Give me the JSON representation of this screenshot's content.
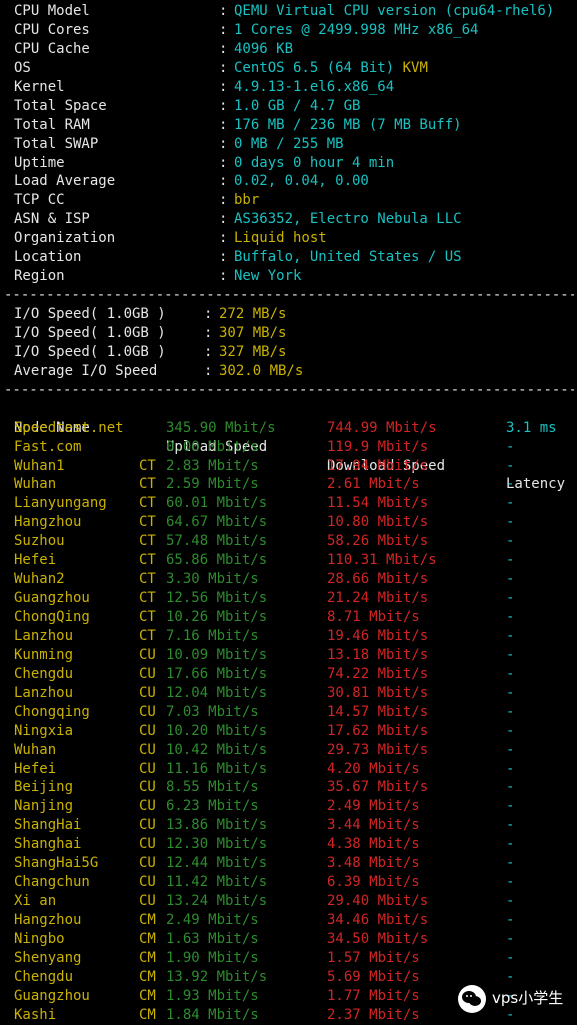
{
  "sysinfo": [
    {
      "label": "CPU Model",
      "value": "QEMU Virtual CPU version (cpu64-rhel6)"
    },
    {
      "label": "CPU Cores",
      "value": "1 Cores @ 2499.998 MHz x86_64"
    },
    {
      "label": "CPU Cache",
      "value": "4096 KB"
    },
    {
      "label": "OS",
      "value": "CentOS 6.5 (64 Bit)",
      "suffix": "KVM"
    },
    {
      "label": "Kernel",
      "value": "4.9.13-1.el6.x86_64"
    },
    {
      "label": "Total Space",
      "value": "1.0 GB / 4.7 GB"
    },
    {
      "label": "Total RAM",
      "value": "176 MB / 236 MB (7 MB Buff)"
    },
    {
      "label": "Total SWAP",
      "value": "0 MB / 255 MB"
    },
    {
      "label": "Uptime",
      "value": "0 days 0 hour 4 min"
    },
    {
      "label": "Load Average",
      "value": "0.02, 0.04, 0.00"
    },
    {
      "label": "TCP CC",
      "value": "bbr",
      "yellow": true
    },
    {
      "label": "ASN & ISP",
      "value": "AS36352, Electro Nebula LLC"
    },
    {
      "label": "Organization",
      "value": "Liquid host",
      "yellow": true
    },
    {
      "label": "Location",
      "value": "Buffalo, United States / US"
    },
    {
      "label": "Region",
      "value": "New York"
    }
  ],
  "io": [
    {
      "label": "I/O Speed( 1.0GB )",
      "value": "272 MB/s"
    },
    {
      "label": "I/O Speed( 1.0GB )",
      "value": "307 MB/s"
    },
    {
      "label": "I/O Speed( 1.0GB )",
      "value": "327 MB/s"
    },
    {
      "label": "Average I/O Speed",
      "value": "302.0 MB/s"
    }
  ],
  "speed_header": {
    "node": "Node Name",
    "upload": "Upload Speed",
    "download": "Download Speed",
    "latency": "Latency"
  },
  "speed_rows": [
    {
      "node": "Speedtest.net",
      "isp": "",
      "up": "345.90 Mbit/s",
      "down": "744.99 Mbit/s",
      "lat": "3.1 ms"
    },
    {
      "node": "Fast.com",
      "isp": "",
      "up": "0.00 Mbit/s",
      "down": "119.9 Mbit/s",
      "lat": "-"
    },
    {
      "node": "Wuhan1",
      "isp": "CT",
      "up": "2.83 Mbit/s",
      "down": "17.94 Mbit/s",
      "lat": "-"
    },
    {
      "node": "Wuhan",
      "isp": "CT",
      "up": "2.59 Mbit/s",
      "down": "2.61 Mbit/s",
      "lat": "-"
    },
    {
      "node": "Lianyungang",
      "isp": "CT",
      "up": "60.01 Mbit/s",
      "down": "11.54 Mbit/s",
      "lat": "-"
    },
    {
      "node": "Hangzhou",
      "isp": "CT",
      "up": "64.67 Mbit/s",
      "down": "10.80 Mbit/s",
      "lat": "-"
    },
    {
      "node": "Suzhou",
      "isp": "CT",
      "up": "57.48 Mbit/s",
      "down": "58.26 Mbit/s",
      "lat": "-"
    },
    {
      "node": "Hefei",
      "isp": "CT",
      "up": "65.86 Mbit/s",
      "down": "110.31 Mbit/s",
      "lat": "-"
    },
    {
      "node": "Wuhan2",
      "isp": "CT",
      "up": "3.30 Mbit/s",
      "down": "28.66 Mbit/s",
      "lat": "-"
    },
    {
      "node": "Guangzhou",
      "isp": "CT",
      "up": "12.56 Mbit/s",
      "down": "21.24 Mbit/s",
      "lat": "-"
    },
    {
      "node": "ChongQing",
      "isp": "CT",
      "up": "10.26 Mbit/s",
      "down": "8.71 Mbit/s",
      "lat": "-"
    },
    {
      "node": "Lanzhou",
      "isp": "CT",
      "up": "7.16 Mbit/s",
      "down": "19.46 Mbit/s",
      "lat": "-"
    },
    {
      "node": "Kunming",
      "isp": "CU",
      "up": "10.09 Mbit/s",
      "down": "13.18 Mbit/s",
      "lat": "-"
    },
    {
      "node": "Chengdu",
      "isp": "CU",
      "up": "17.66 Mbit/s",
      "down": "74.22 Mbit/s",
      "lat": "-"
    },
    {
      "node": "Lanzhou",
      "isp": "CU",
      "up": "12.04 Mbit/s",
      "down": "30.81 Mbit/s",
      "lat": "-"
    },
    {
      "node": "Chongqing",
      "isp": "CU",
      "up": "7.03 Mbit/s",
      "down": "14.57 Mbit/s",
      "lat": "-"
    },
    {
      "node": "Ningxia",
      "isp": "CU",
      "up": "10.20 Mbit/s",
      "down": "17.62 Mbit/s",
      "lat": "-"
    },
    {
      "node": "Wuhan",
      "isp": "CU",
      "up": "10.42 Mbit/s",
      "down": "29.73 Mbit/s",
      "lat": "-"
    },
    {
      "node": "Hefei",
      "isp": "CU",
      "up": "11.16 Mbit/s",
      "down": "4.20 Mbit/s",
      "lat": "-"
    },
    {
      "node": "Beijing",
      "isp": "CU",
      "up": "8.55 Mbit/s",
      "down": "35.67 Mbit/s",
      "lat": "-"
    },
    {
      "node": "Nanjing",
      "isp": "CU",
      "up": "6.23 Mbit/s",
      "down": "2.49 Mbit/s",
      "lat": "-"
    },
    {
      "node": "ShangHai",
      "isp": "CU",
      "up": "13.86 Mbit/s",
      "down": "3.44 Mbit/s",
      "lat": "-"
    },
    {
      "node": "Shanghai",
      "isp": "CU",
      "up": "12.30 Mbit/s",
      "down": "4.38 Mbit/s",
      "lat": "-"
    },
    {
      "node": "ShangHai5G",
      "isp": "CU",
      "up": "12.44 Mbit/s",
      "down": "3.48 Mbit/s",
      "lat": "-"
    },
    {
      "node": "Changchun",
      "isp": "CU",
      "up": "11.42 Mbit/s",
      "down": "6.39 Mbit/s",
      "lat": "-"
    },
    {
      "node": "Xi an",
      "isp": "CU",
      "up": "13.24 Mbit/s",
      "down": "29.40 Mbit/s",
      "lat": "-"
    },
    {
      "node": "Hangzhou",
      "isp": "CM",
      "up": "2.49 Mbit/s",
      "down": "34.46 Mbit/s",
      "lat": "-"
    },
    {
      "node": "Ningbo",
      "isp": "CM",
      "up": "1.63 Mbit/s",
      "down": "34.50 Mbit/s",
      "lat": "-"
    },
    {
      "node": "Shenyang",
      "isp": "CM",
      "up": "1.90 Mbit/s",
      "down": "1.57 Mbit/s",
      "lat": "-"
    },
    {
      "node": "Chengdu",
      "isp": "CM",
      "up": "13.92 Mbit/s",
      "down": "5.69 Mbit/s",
      "lat": "-"
    },
    {
      "node": "Guangzhou",
      "isp": "CM",
      "up": "1.93 Mbit/s",
      "down": "1.77 Mbit/s",
      "lat": "-"
    },
    {
      "node": "Kashi",
      "isp": "CM",
      "up": "1.84 Mbit/s",
      "down": "2.37 Mbit/s",
      "lat": "-"
    }
  ],
  "watermark": {
    "text": "vps小学生",
    "icon": "wechat-icon"
  },
  "colors": {
    "background": "#000000",
    "cyan": "#19c1c1",
    "yellow": "#c9b200",
    "green": "#2e8b2e",
    "red": "#d12525",
    "white": "#e6e6e6"
  }
}
